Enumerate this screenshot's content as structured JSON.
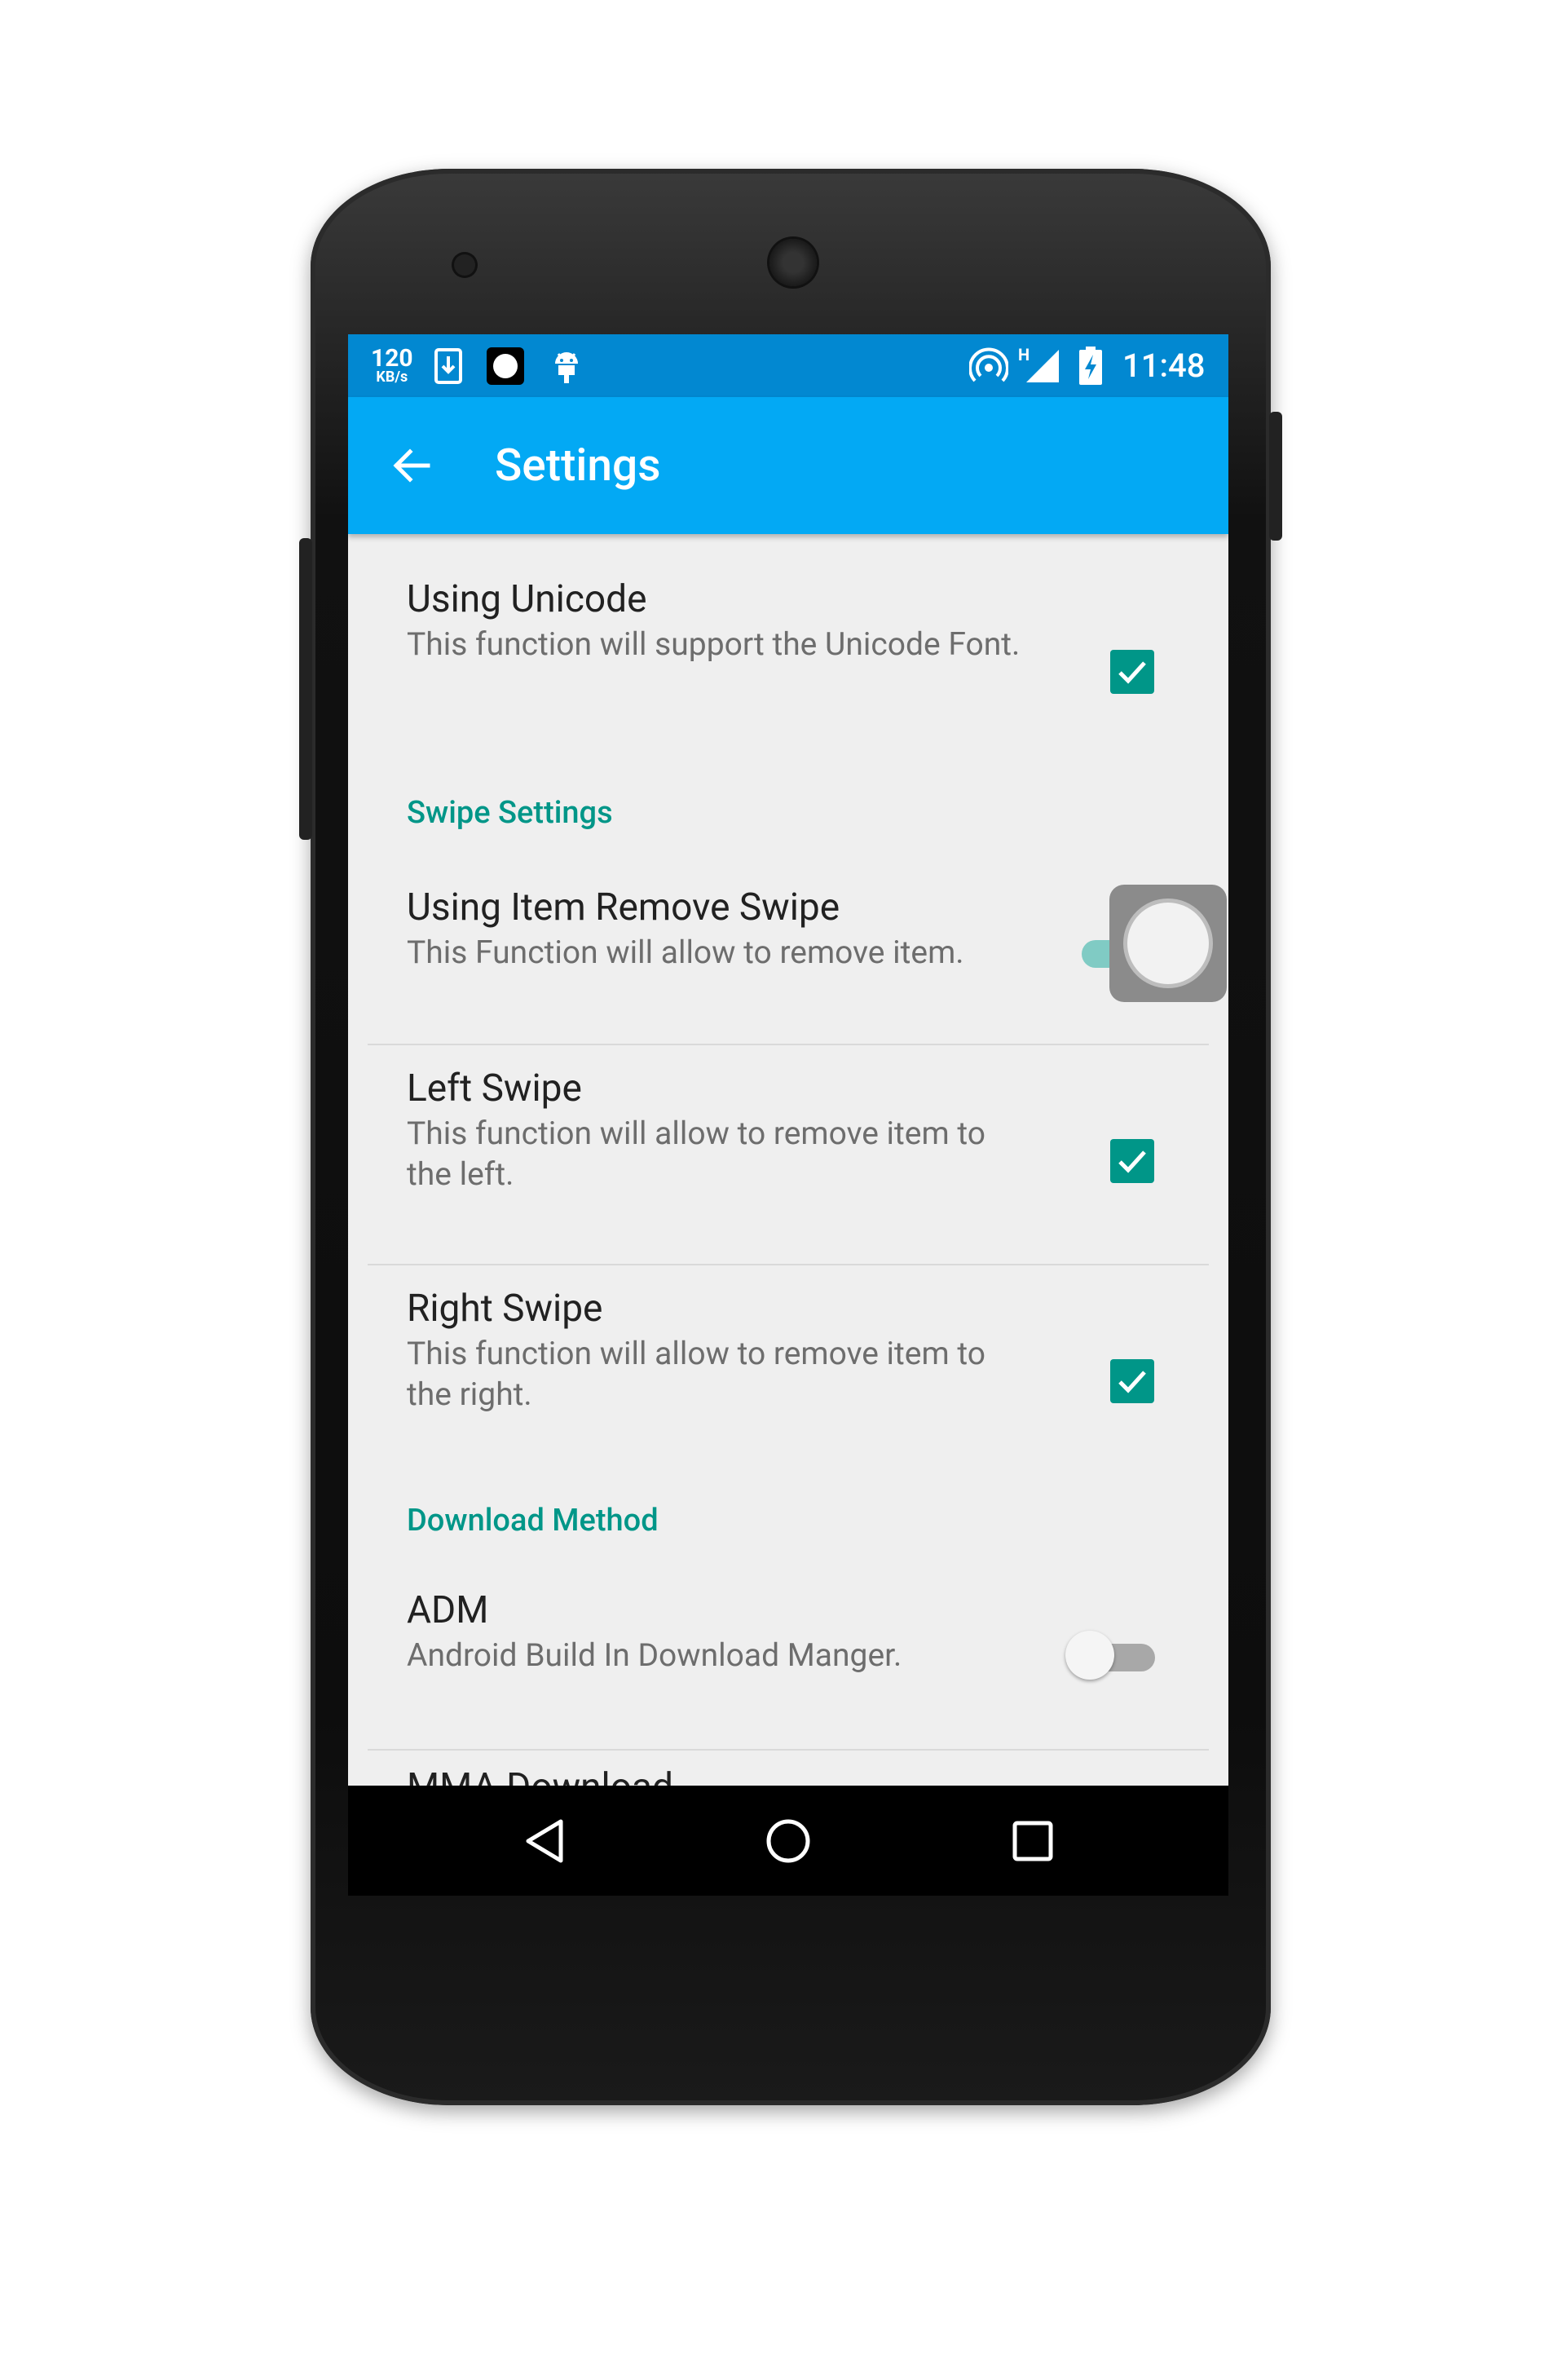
{
  "status_bar": {
    "speed_value": "120",
    "speed_unit": "KB/s",
    "network_type": "H",
    "time": "11:48",
    "icons": [
      "download-icon",
      "record-icon",
      "android-icon",
      "hotspot-icon",
      "signal-icon",
      "battery-charging-icon"
    ]
  },
  "app_bar": {
    "title": "Settings",
    "back_icon": "arrow-left-icon"
  },
  "settings": {
    "using_unicode": {
      "title": "Using Unicode",
      "summary": "This function will support the Unicode Font.",
      "checked": true
    },
    "swipe_category": "Swipe Settings",
    "item_remove_swipe": {
      "title": "Using Item Remove Swipe",
      "summary": "This Function will allow to remove item.",
      "enabled": true
    },
    "left_swipe": {
      "title": "Left Swipe",
      "summary": "This function will allow to remove item to the left.",
      "checked": true
    },
    "right_swipe": {
      "title": "Right Swipe",
      "summary": "This function will allow to remove item to the right.",
      "checked": true
    },
    "download_category": "Download Method",
    "adm": {
      "title": "ADM",
      "summary": "Android Build In Download Manger.",
      "enabled": false
    },
    "next_partial": "MMA Download"
  },
  "colors": {
    "status_bar": "#0288d1",
    "app_bar": "#03a9f4",
    "accent": "#009688",
    "background": "#efefef"
  },
  "nav_bar": {
    "icons": [
      "back-triangle-icon",
      "home-circle-icon",
      "recents-square-icon"
    ]
  }
}
